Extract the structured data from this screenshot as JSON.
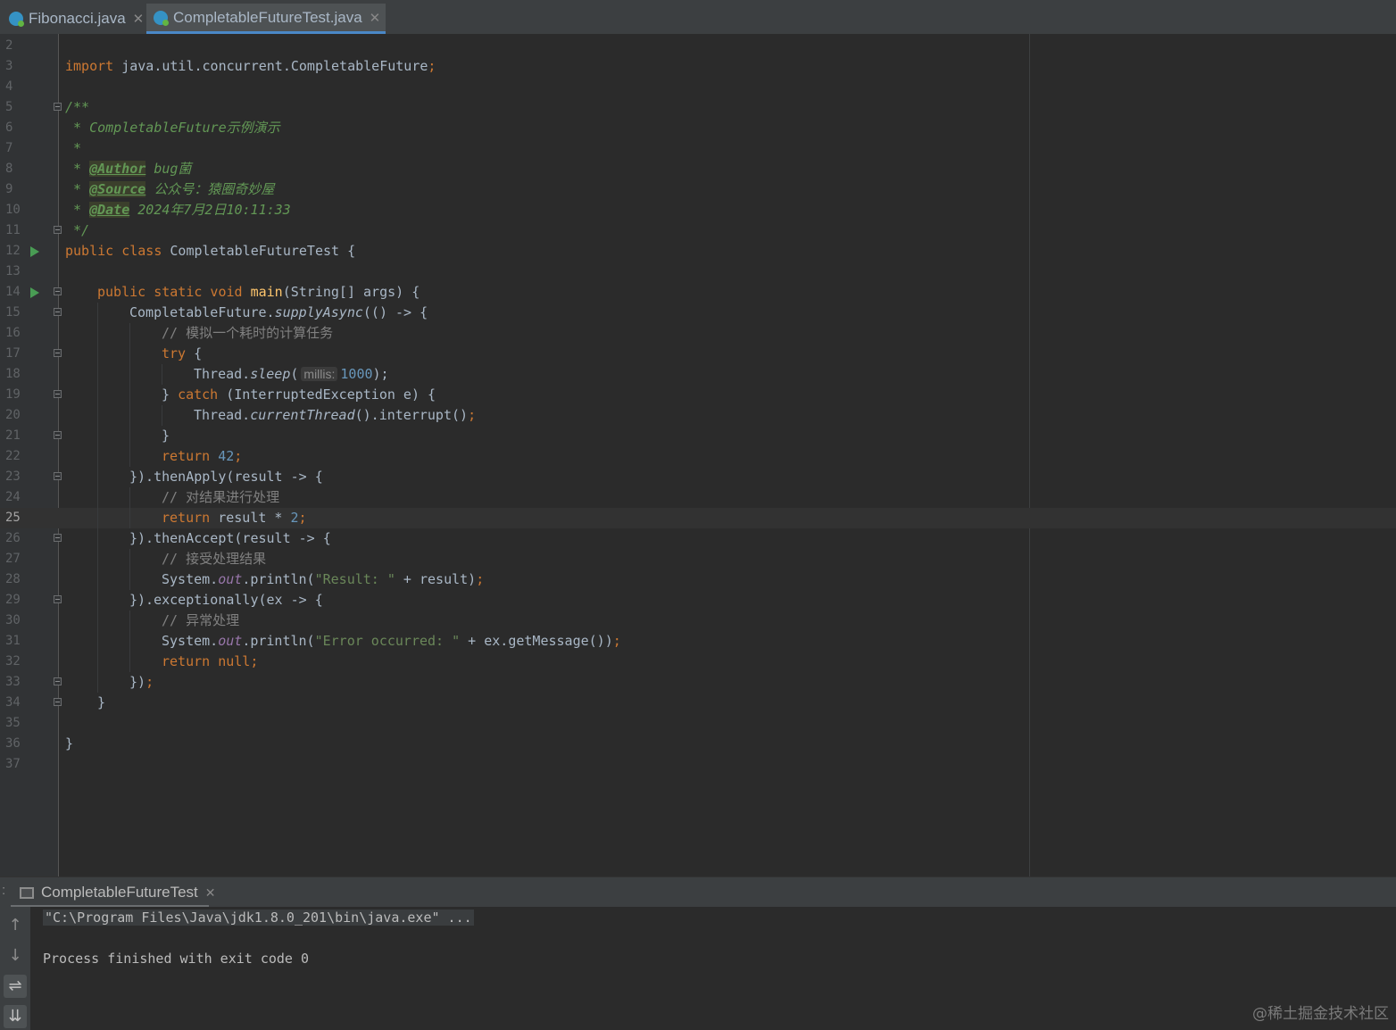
{
  "tabs": [
    {
      "label": "Fibonacci.java",
      "icon": "java-class-icon"
    },
    {
      "label": "CompletableFutureTest.java",
      "icon": "java-class-icon",
      "active": true
    }
  ],
  "editor": {
    "current_line": 25,
    "line_numbers": [
      "2",
      "3",
      "4",
      "5",
      "6",
      "7",
      "8",
      "9",
      "10",
      "11",
      "12",
      "13",
      "14",
      "15",
      "16",
      "17",
      "18",
      "19",
      "20",
      "21",
      "22",
      "23",
      "24",
      "25",
      "26",
      "27",
      "28",
      "29",
      "30",
      "31",
      "32",
      "33",
      "34",
      "35",
      "36",
      "37"
    ],
    "code": {
      "l3_import": "import",
      "l3_pkg": " java.util.concurrent.CompletableFuture",
      "l3_semi": ";",
      "l5": "/**",
      "l6": " * CompletableFuture示例演示",
      "l7": " *",
      "l8_star": " * ",
      "l8_tag": "@Author",
      "l8_val": " bug菌",
      "l9_star": " * ",
      "l9_tag": "@Source",
      "l9_val": " 公众号：猿圈奇妙屋",
      "l10_star": " * ",
      "l10_tag": "@Date",
      "l10_val": " 2024年7月2日10:11:33",
      "l11": " */",
      "l12_kw": "public class",
      "l12_rest": " CompletableFutureTest {",
      "l14_kw": "public static void",
      "l14_fn": "main",
      "l14_rest": "(String[] args) {",
      "l15_a": "CompletableFuture.",
      "l15_b": "supplyAsync",
      "l15_c": "(() -> {",
      "l16": "// 模拟一个耗时的计算任务",
      "l17_kw": "try",
      "l17_rest": " {",
      "l18_a": "Thread.",
      "l18_b": "sleep",
      "l18_c": "(",
      "l18_hint": "millis:",
      "l18_num": "1000",
      "l18_d": ");",
      "l19_a": "} ",
      "l19_kw": "catch",
      "l19_rest": " (InterruptedException e) {",
      "l20_a": "Thread.",
      "l20_b": "currentThread",
      "l20_c": "().interrupt()",
      "l20_semi": ";",
      "l21": "}",
      "l22_kw": "return",
      "l22_num": " 42",
      "l22_semi": ";",
      "l23": "}).thenApply(result -> {",
      "l24": "// 对结果进行处理",
      "l25_kw": "return",
      "l25_rest": " result * ",
      "l25_num": "2",
      "l25_semi": ";",
      "l26": "}).thenAccept(result -> {",
      "l27": "// 接受处理结果",
      "l28_a": "System.",
      "l28_b": "out",
      "l28_c": ".println(",
      "l28_str": "\"Result: \"",
      "l28_d": " + result)",
      "l28_semi": ";",
      "l29": "}).exceptionally(ex -> {",
      "l30": "// 异常处理",
      "l31_a": "System.",
      "l31_b": "out",
      "l31_c": ".println(",
      "l31_str": "\"Error occurred: \"",
      "l31_d": " + ex.getMessage())",
      "l31_semi": ";",
      "l32_kw": "return",
      "l32_null": " null",
      "l32_semi": ";",
      "l33_a": "})",
      "l33_semi": ";",
      "l34": "}",
      "l36": "}"
    }
  },
  "run_panel": {
    "tab_label": "CompletableFutureTest",
    "command": "\"C:\\Program Files\\Java\\jdk1.8.0_201\\bin\\java.exe\" ...",
    "exit_message": "Process finished with exit code 0",
    "side_marker": ":"
  },
  "watermark": "@稀土掘金技术社区",
  "colors": {
    "background": "#2b2b2b",
    "keyword": "#cc7832",
    "method": "#ffc66d",
    "number": "#6897bb",
    "string": "#6a8759",
    "comment": "#808080",
    "doc_comment": "#629755",
    "accent": "#4a88c7"
  }
}
